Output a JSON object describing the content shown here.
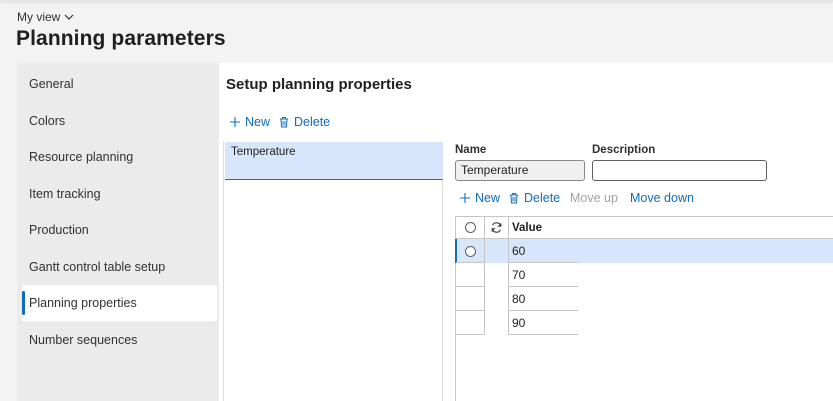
{
  "header": {
    "my_view_label": "My view",
    "page_title": "Planning parameters"
  },
  "nav": {
    "items": [
      {
        "label": "General",
        "selected": false
      },
      {
        "label": "Colors",
        "selected": false
      },
      {
        "label": "Resource planning",
        "selected": false
      },
      {
        "label": "Item tracking",
        "selected": false
      },
      {
        "label": "Production",
        "selected": false
      },
      {
        "label": "Gantt control table setup",
        "selected": false
      },
      {
        "label": "Planning properties",
        "selected": true
      },
      {
        "label": "Number sequences",
        "selected": false
      }
    ]
  },
  "section": {
    "title": "Setup planning properties",
    "toolbar": {
      "new_label": "New",
      "delete_label": "Delete"
    },
    "list": [
      {
        "label": "Temperature",
        "selected": true
      }
    ]
  },
  "detail": {
    "name_label": "Name",
    "name_value": "Temperature",
    "description_label": "Description",
    "description_value": "",
    "toolbar": {
      "new_label": "New",
      "delete_label": "Delete",
      "move_up_label": "Move up",
      "move_down_label": "Move down"
    },
    "grid": {
      "value_header": "Value",
      "rows": [
        {
          "value": "60",
          "selected": true
        },
        {
          "value": "70",
          "selected": false
        },
        {
          "value": "80",
          "selected": false
        },
        {
          "value": "90",
          "selected": false
        }
      ]
    }
  },
  "colors": {
    "accent": "#0f6cbd",
    "selected_row": "#d8e6fb",
    "nav_background": "#ebebeb",
    "page_background": "#f3f3f3"
  }
}
